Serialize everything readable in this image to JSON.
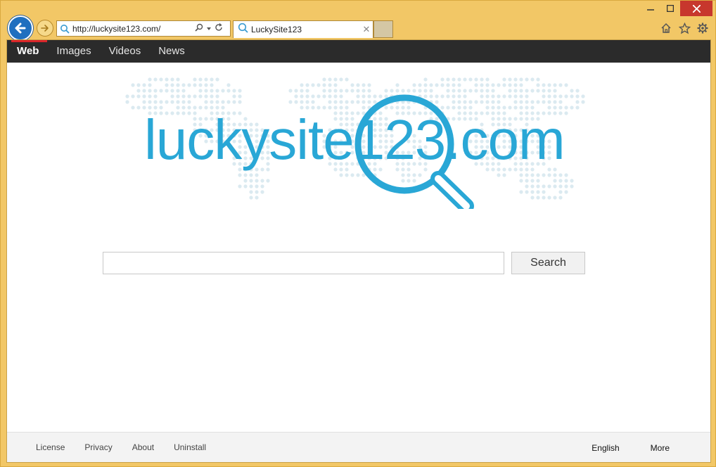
{
  "browser": {
    "address": {
      "url": "http://luckysite123.com/"
    },
    "tab": {
      "title": "LuckySite123"
    },
    "icons": {
      "back": "back-arrow-icon",
      "forward": "forward-arrow-icon",
      "search": "search-icon",
      "dropdown": "chevron-down-icon",
      "refresh": "refresh-icon",
      "close_tab": "close-icon",
      "home": "home-icon",
      "favorites": "star-icon",
      "settings": "gear-icon",
      "minimize": "minimize-icon",
      "maximize": "maximize-icon",
      "close_window": "close-icon"
    },
    "frame_color": "#f2c766"
  },
  "site": {
    "nav": [
      "Web",
      "Images",
      "Videos",
      "News"
    ],
    "active_nav": "Web",
    "logo_text": "luckysite123.com",
    "search": {
      "value": "",
      "button_label": "Search"
    },
    "footer": {
      "left": [
        "License",
        "Privacy",
        "About",
        "Uninstall"
      ],
      "language": "English",
      "more": "More"
    },
    "colors": {
      "brand": "#29a7d6",
      "nav_bg": "#2b2b2b",
      "active_indicator": "#d9262b",
      "map_dots": "#dbeaf0"
    }
  }
}
